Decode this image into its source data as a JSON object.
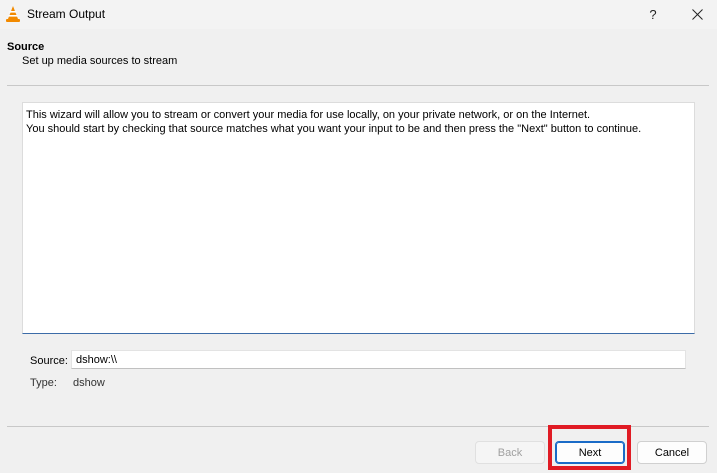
{
  "window": {
    "title": "Stream Output",
    "icon": "vlc-cone-icon",
    "help_label": "?",
    "close_icon": "close-icon"
  },
  "header": {
    "title": "Source",
    "subtitle": "Set up media sources to stream"
  },
  "description": "This wizard will allow you to stream or convert your media for use locally, on your private network, or on the Internet.\nYou should start by checking that source matches what you want your input to be and then press the \"Next\" button to continue.",
  "source": {
    "label": "Source:",
    "value": "dshow:\\\\",
    "type_label": "Type:",
    "type_value": "dshow"
  },
  "buttons": {
    "back": "Back",
    "next": "Next",
    "cancel": "Cancel"
  },
  "colors": {
    "highlight": "#e01b24",
    "vlc_orange": "#f28a00",
    "default_button_border": "#1a6bc7"
  }
}
